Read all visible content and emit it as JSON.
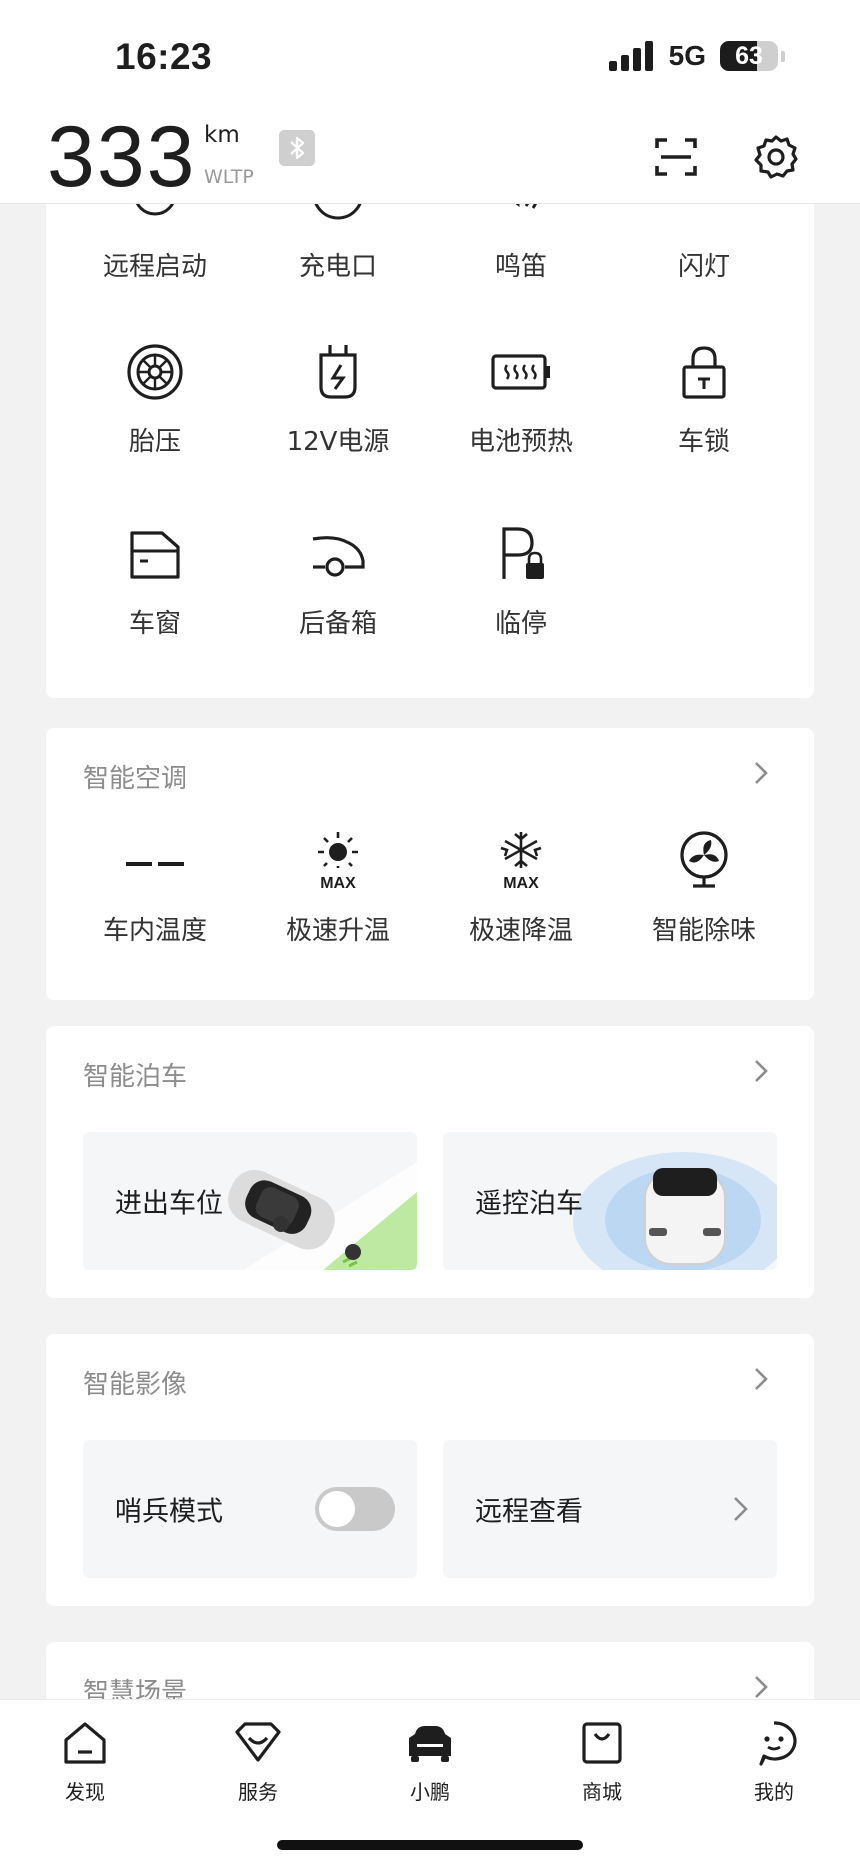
{
  "status_bar": {
    "time": "16:23",
    "network": "5G",
    "battery": "63",
    "battery_level": 0.63
  },
  "header": {
    "range_value": "333",
    "range_unit": "km",
    "range_standard": "WLTP",
    "icons": [
      "bluetooth-icon",
      "scan-icon",
      "settings-icon"
    ]
  },
  "controls": {
    "row1": [
      {
        "label": "远程启动",
        "icon": "remote-start-icon"
      },
      {
        "label": "充电口",
        "icon": "charge-port-icon"
      },
      {
        "label": "鸣笛",
        "icon": "horn-icon"
      },
      {
        "label": "闪灯",
        "icon": "flash-lights-icon"
      }
    ],
    "row2": [
      {
        "label": "胎压",
        "icon": "tire-pressure-icon"
      },
      {
        "label": "12V电源",
        "icon": "power-12v-icon"
      },
      {
        "label": "电池预热",
        "icon": "battery-preheat-icon"
      },
      {
        "label": "车锁",
        "icon": "car-lock-icon"
      }
    ],
    "row3": [
      {
        "label": "车窗",
        "icon": "window-icon"
      },
      {
        "label": "后备箱",
        "icon": "trunk-icon"
      },
      {
        "label": "临停",
        "icon": "temp-parking-icon"
      }
    ]
  },
  "climate": {
    "title": "智能空调",
    "items": [
      {
        "label": "车内温度",
        "value": "——",
        "icon": "cabin-temp-icon"
      },
      {
        "label": "极速升温",
        "icon": "max-heat-icon",
        "badge": "MAX"
      },
      {
        "label": "极速降温",
        "icon": "max-cool-icon",
        "badge": "MAX"
      },
      {
        "label": "智能除味",
        "icon": "fan-icon"
      }
    ]
  },
  "parking": {
    "title": "智能泊车",
    "tiles": [
      {
        "label": "进出车位",
        "image": "car-parking-illustration"
      },
      {
        "label": "遥控泊车",
        "image": "remote-parking-illustration"
      }
    ]
  },
  "camera": {
    "title": "智能影像",
    "sentry_label": "哨兵模式",
    "sentry_on": false,
    "remote_view_label": "远程查看"
  },
  "scenes": {
    "title": "智慧场景"
  },
  "tabbar": {
    "tabs": [
      {
        "label": "发现",
        "icon": "discover-icon"
      },
      {
        "label": "服务",
        "icon": "service-icon"
      },
      {
        "label": "小鹏",
        "icon": "car-icon",
        "active": true
      },
      {
        "label": "商城",
        "icon": "shop-icon"
      },
      {
        "label": "我的",
        "icon": "profile-icon"
      }
    ]
  },
  "colors": {
    "accent_green": "#8bd957",
    "tile_bg": "#f4f6f8",
    "remote_blue": "#cfe3f7"
  }
}
